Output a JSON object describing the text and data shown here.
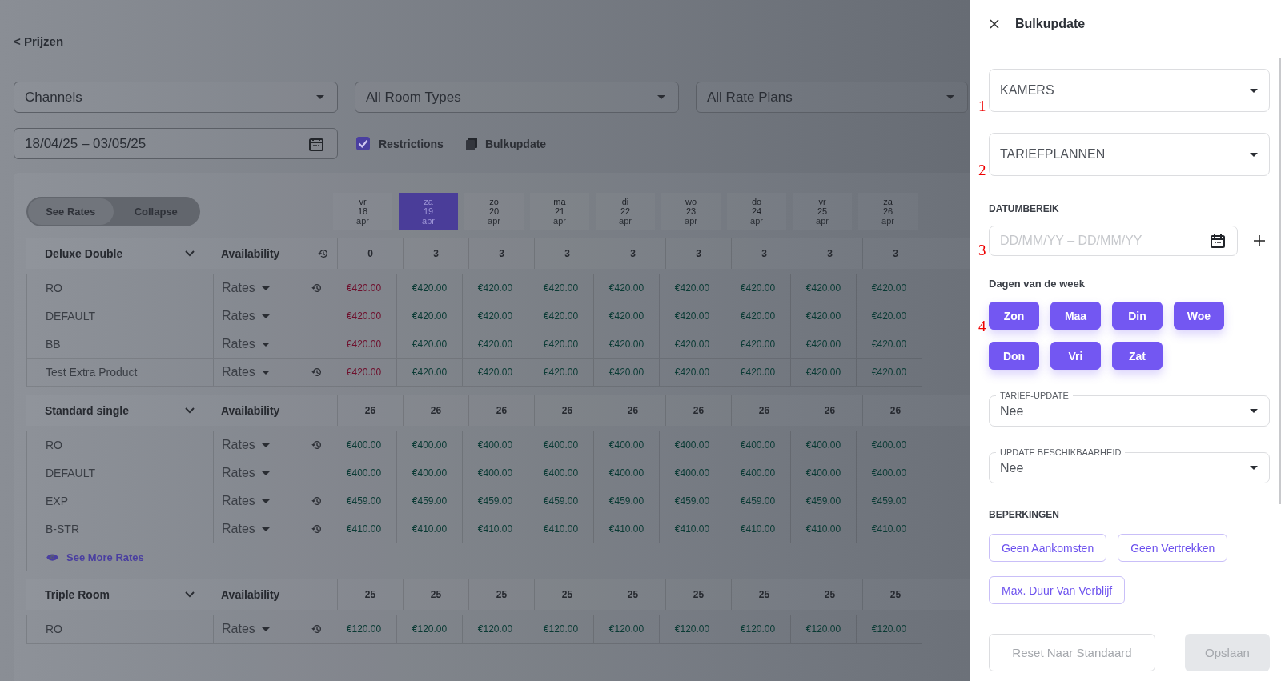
{
  "back_link": "< Prijzen",
  "filters": [
    {
      "placeholder": "Channels"
    },
    {
      "placeholder": "All Room Types"
    },
    {
      "placeholder": "All Rate Plans"
    }
  ],
  "date_range": {
    "value": "18/04/25 – 03/05/25"
  },
  "restrictions": {
    "label": "Restrictions",
    "checked": true
  },
  "bulkupdate_link": "Bulkupdate",
  "view_toggle": [
    {
      "label": "See Rates",
      "selected": true
    },
    {
      "label": "Collapse",
      "selected": false
    }
  ],
  "dates": [
    {
      "weekday": "vr",
      "day": "18",
      "month": "apr",
      "selected": false
    },
    {
      "weekday": "za",
      "day": "19",
      "month": "apr",
      "selected": true
    },
    {
      "weekday": "zo",
      "day": "20",
      "month": "apr",
      "selected": false
    },
    {
      "weekday": "ma",
      "day": "21",
      "month": "apr",
      "selected": false
    },
    {
      "weekday": "di",
      "day": "22",
      "month": "apr",
      "selected": false
    },
    {
      "weekday": "wo",
      "day": "23",
      "month": "apr",
      "selected": false
    },
    {
      "weekday": "do",
      "day": "24",
      "month": "apr",
      "selected": false
    },
    {
      "weekday": "vr",
      "day": "25",
      "month": "apr",
      "selected": false
    },
    {
      "weekday": "za",
      "day": "26",
      "month": "apr",
      "selected": false
    }
  ],
  "groups": [
    {
      "name": "Deluxe Double",
      "label": "Availability",
      "history": true,
      "availability": [
        "0",
        "3",
        "3",
        "3",
        "3",
        "3",
        "3",
        "3",
        "3"
      ],
      "rates": [
        {
          "name": "RO",
          "menu": "Rates",
          "history": true,
          "prices": [
            "€420.00",
            "€420.00",
            "€420.00",
            "€420.00",
            "€420.00",
            "€420.00",
            "€420.00",
            "€420.00",
            "€420.00"
          ],
          "alerts": [
            true,
            false,
            false,
            false,
            false,
            false,
            false,
            false,
            false
          ]
        },
        {
          "name": "DEFAULT",
          "menu": "Rates",
          "history": false,
          "prices": [
            "€420.00",
            "€420.00",
            "€420.00",
            "€420.00",
            "€420.00",
            "€420.00",
            "€420.00",
            "€420.00",
            "€420.00"
          ],
          "alerts": [
            true,
            false,
            false,
            false,
            false,
            false,
            false,
            false,
            false
          ]
        },
        {
          "name": "BB",
          "menu": "Rates",
          "history": false,
          "prices": [
            "€420.00",
            "€420.00",
            "€420.00",
            "€420.00",
            "€420.00",
            "€420.00",
            "€420.00",
            "€420.00",
            "€420.00"
          ],
          "alerts": [
            true,
            false,
            false,
            false,
            false,
            false,
            false,
            false,
            false
          ]
        },
        {
          "name": "Test Extra Product",
          "menu": "Rates",
          "history": true,
          "prices": [
            "€420.00",
            "€420.00",
            "€420.00",
            "€420.00",
            "€420.00",
            "€420.00",
            "€420.00",
            "€420.00",
            "€420.00"
          ],
          "alerts": [
            true,
            false,
            false,
            false,
            false,
            false,
            false,
            false,
            false
          ]
        }
      ]
    },
    {
      "name": "Standard single",
      "label": "Availability",
      "history": false,
      "availability": [
        "26",
        "26",
        "26",
        "26",
        "26",
        "26",
        "26",
        "26",
        "26"
      ],
      "rates": [
        {
          "name": "RO",
          "menu": "Rates",
          "history": true,
          "prices": [
            "€400.00",
            "€400.00",
            "€400.00",
            "€400.00",
            "€400.00",
            "€400.00",
            "€400.00",
            "€400.00",
            "€400.00"
          ],
          "alerts": [
            false,
            false,
            false,
            false,
            false,
            false,
            false,
            false,
            false
          ]
        },
        {
          "name": "DEFAULT",
          "menu": "Rates",
          "history": false,
          "prices": [
            "€400.00",
            "€400.00",
            "€400.00",
            "€400.00",
            "€400.00",
            "€400.00",
            "€400.00",
            "€400.00",
            "€400.00"
          ],
          "alerts": [
            false,
            false,
            false,
            false,
            false,
            false,
            false,
            false,
            false
          ]
        },
        {
          "name": "EXP",
          "menu": "Rates",
          "history": true,
          "prices": [
            "€459.00",
            "€459.00",
            "€459.00",
            "€459.00",
            "€459.00",
            "€459.00",
            "€459.00",
            "€459.00",
            "€459.00"
          ],
          "alerts": [
            false,
            false,
            false,
            false,
            false,
            false,
            false,
            false,
            false
          ]
        },
        {
          "name": "B-STR",
          "menu": "Rates",
          "history": true,
          "prices": [
            "€410.00",
            "€410.00",
            "€410.00",
            "€410.00",
            "€410.00",
            "€410.00",
            "€410.00",
            "€410.00",
            "€410.00"
          ],
          "alerts": [
            false,
            false,
            false,
            false,
            false,
            false,
            false,
            false,
            false
          ]
        }
      ],
      "more_link": "See More Rates"
    },
    {
      "name": "Triple Room",
      "label": "Availability",
      "history": false,
      "availability": [
        "25",
        "25",
        "25",
        "25",
        "25",
        "25",
        "25",
        "25",
        "25"
      ],
      "rates": [
        {
          "name": "RO",
          "menu": "Rates",
          "history": true,
          "prices": [
            "€120.00",
            "€120.00",
            "€120.00",
            "€120.00",
            "€120.00",
            "€120.00",
            "€120.00",
            "€120.00",
            "€120.00"
          ],
          "alerts": [
            false,
            false,
            false,
            false,
            false,
            false,
            false,
            false,
            false
          ]
        }
      ]
    }
  ],
  "drawer": {
    "title": "Bulkupdate",
    "selects": [
      {
        "placeholder": "KAMERS",
        "marker": "1"
      },
      {
        "placeholder": "TARIEFPLANNEN",
        "marker": "2"
      }
    ],
    "date_label": "DATUMBEREIK",
    "date_field": {
      "placeholder": "DD/MM/YY – DD/MM/YY",
      "marker": "3"
    },
    "days_label": "Dagen van de week",
    "days_marker": "4",
    "days": [
      {
        "label": "Zon",
        "selected": true
      },
      {
        "label": "Maa",
        "selected": true
      },
      {
        "label": "Din",
        "selected": true
      },
      {
        "label": "Woe",
        "selected": true
      },
      {
        "label": "Don",
        "selected": true
      },
      {
        "label": "Vri",
        "selected": true
      },
      {
        "label": "Zat",
        "selected": true
      }
    ],
    "updates": [
      {
        "label": "TARIEF-UPDATE",
        "value": "Nee"
      },
      {
        "label": "UPDATE BESCHIKBAARHEID",
        "value": "Nee"
      }
    ],
    "restrictions_label": "BEPERKINGEN",
    "restrictions": [
      "Geen Aankomsten",
      "Geen Vertrekken",
      "Max. Duur Van Verblijf"
    ],
    "reset": {
      "label": "Reset Naar Standaard",
      "disabled": false
    },
    "save": {
      "label": "Opslaan",
      "disabled": true
    }
  }
}
